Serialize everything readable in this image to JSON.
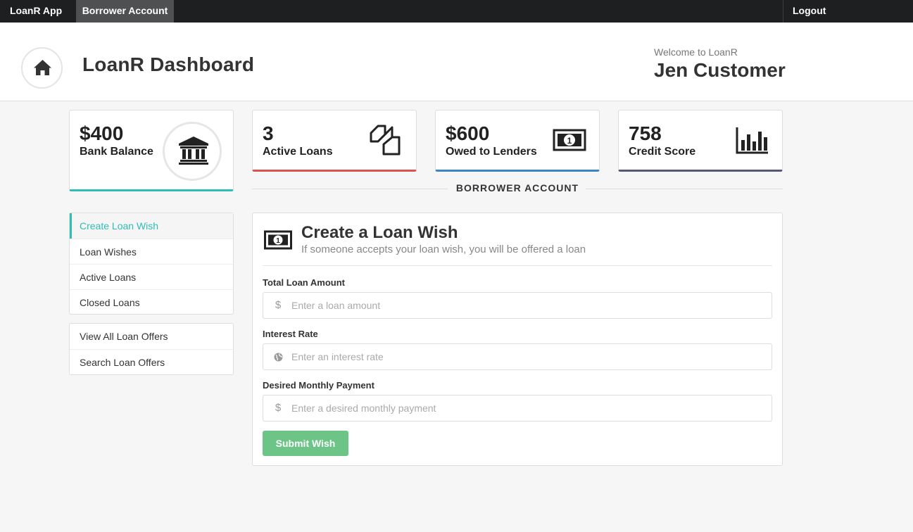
{
  "nav": {
    "brand": "LoanR App",
    "active_tab": "Borrower Account",
    "logout": "Logout"
  },
  "header": {
    "title": "LoanR Dashboard",
    "welcome": "Welcome to LoanR",
    "user_name": "Jen Customer",
    "home_icon": "home-icon"
  },
  "stats": {
    "balance": {
      "value": "$400",
      "label": "Bank Balance",
      "icon": "bank-icon",
      "color": "#2fbdb6"
    },
    "loans": {
      "value": "3",
      "label": "Active Loans",
      "icon": "documents-icon",
      "color": "#d9534f"
    },
    "owed": {
      "value": "$600",
      "label": "Owed to Lenders",
      "icon": "money-bill-icon",
      "color": "#3c85c6"
    },
    "credit": {
      "value": "758",
      "label": "Credit Score",
      "icon": "bar-chart-icon",
      "color": "#55577a"
    }
  },
  "section_title": "BORROWER ACCOUNT",
  "sidebar": {
    "group1": [
      {
        "label": "Create Loan Wish",
        "active": true
      },
      {
        "label": "Loan Wishes"
      },
      {
        "label": "Active Loans"
      },
      {
        "label": "Closed Loans"
      }
    ],
    "group2": [
      {
        "label": "View All Loan Offers"
      },
      {
        "label": "Search Loan Offers"
      }
    ]
  },
  "form": {
    "title": "Create a Loan Wish",
    "subtitle": "If someone accepts your loan wish, you will be offered a loan",
    "fields": [
      {
        "label": "Total Loan Amount",
        "placeholder": "Enter a loan amount",
        "value": "",
        "icon": "dollar-icon"
      },
      {
        "label": "Interest Rate",
        "placeholder": "Enter an interest rate",
        "value": "",
        "icon": "globe-icon"
      },
      {
        "label": "Desired Monthly Payment",
        "placeholder": "Enter a desired monthly payment",
        "value": "",
        "icon": "dollar-icon"
      }
    ],
    "submit": "Submit Wish",
    "submit_color": "#6cc586"
  }
}
